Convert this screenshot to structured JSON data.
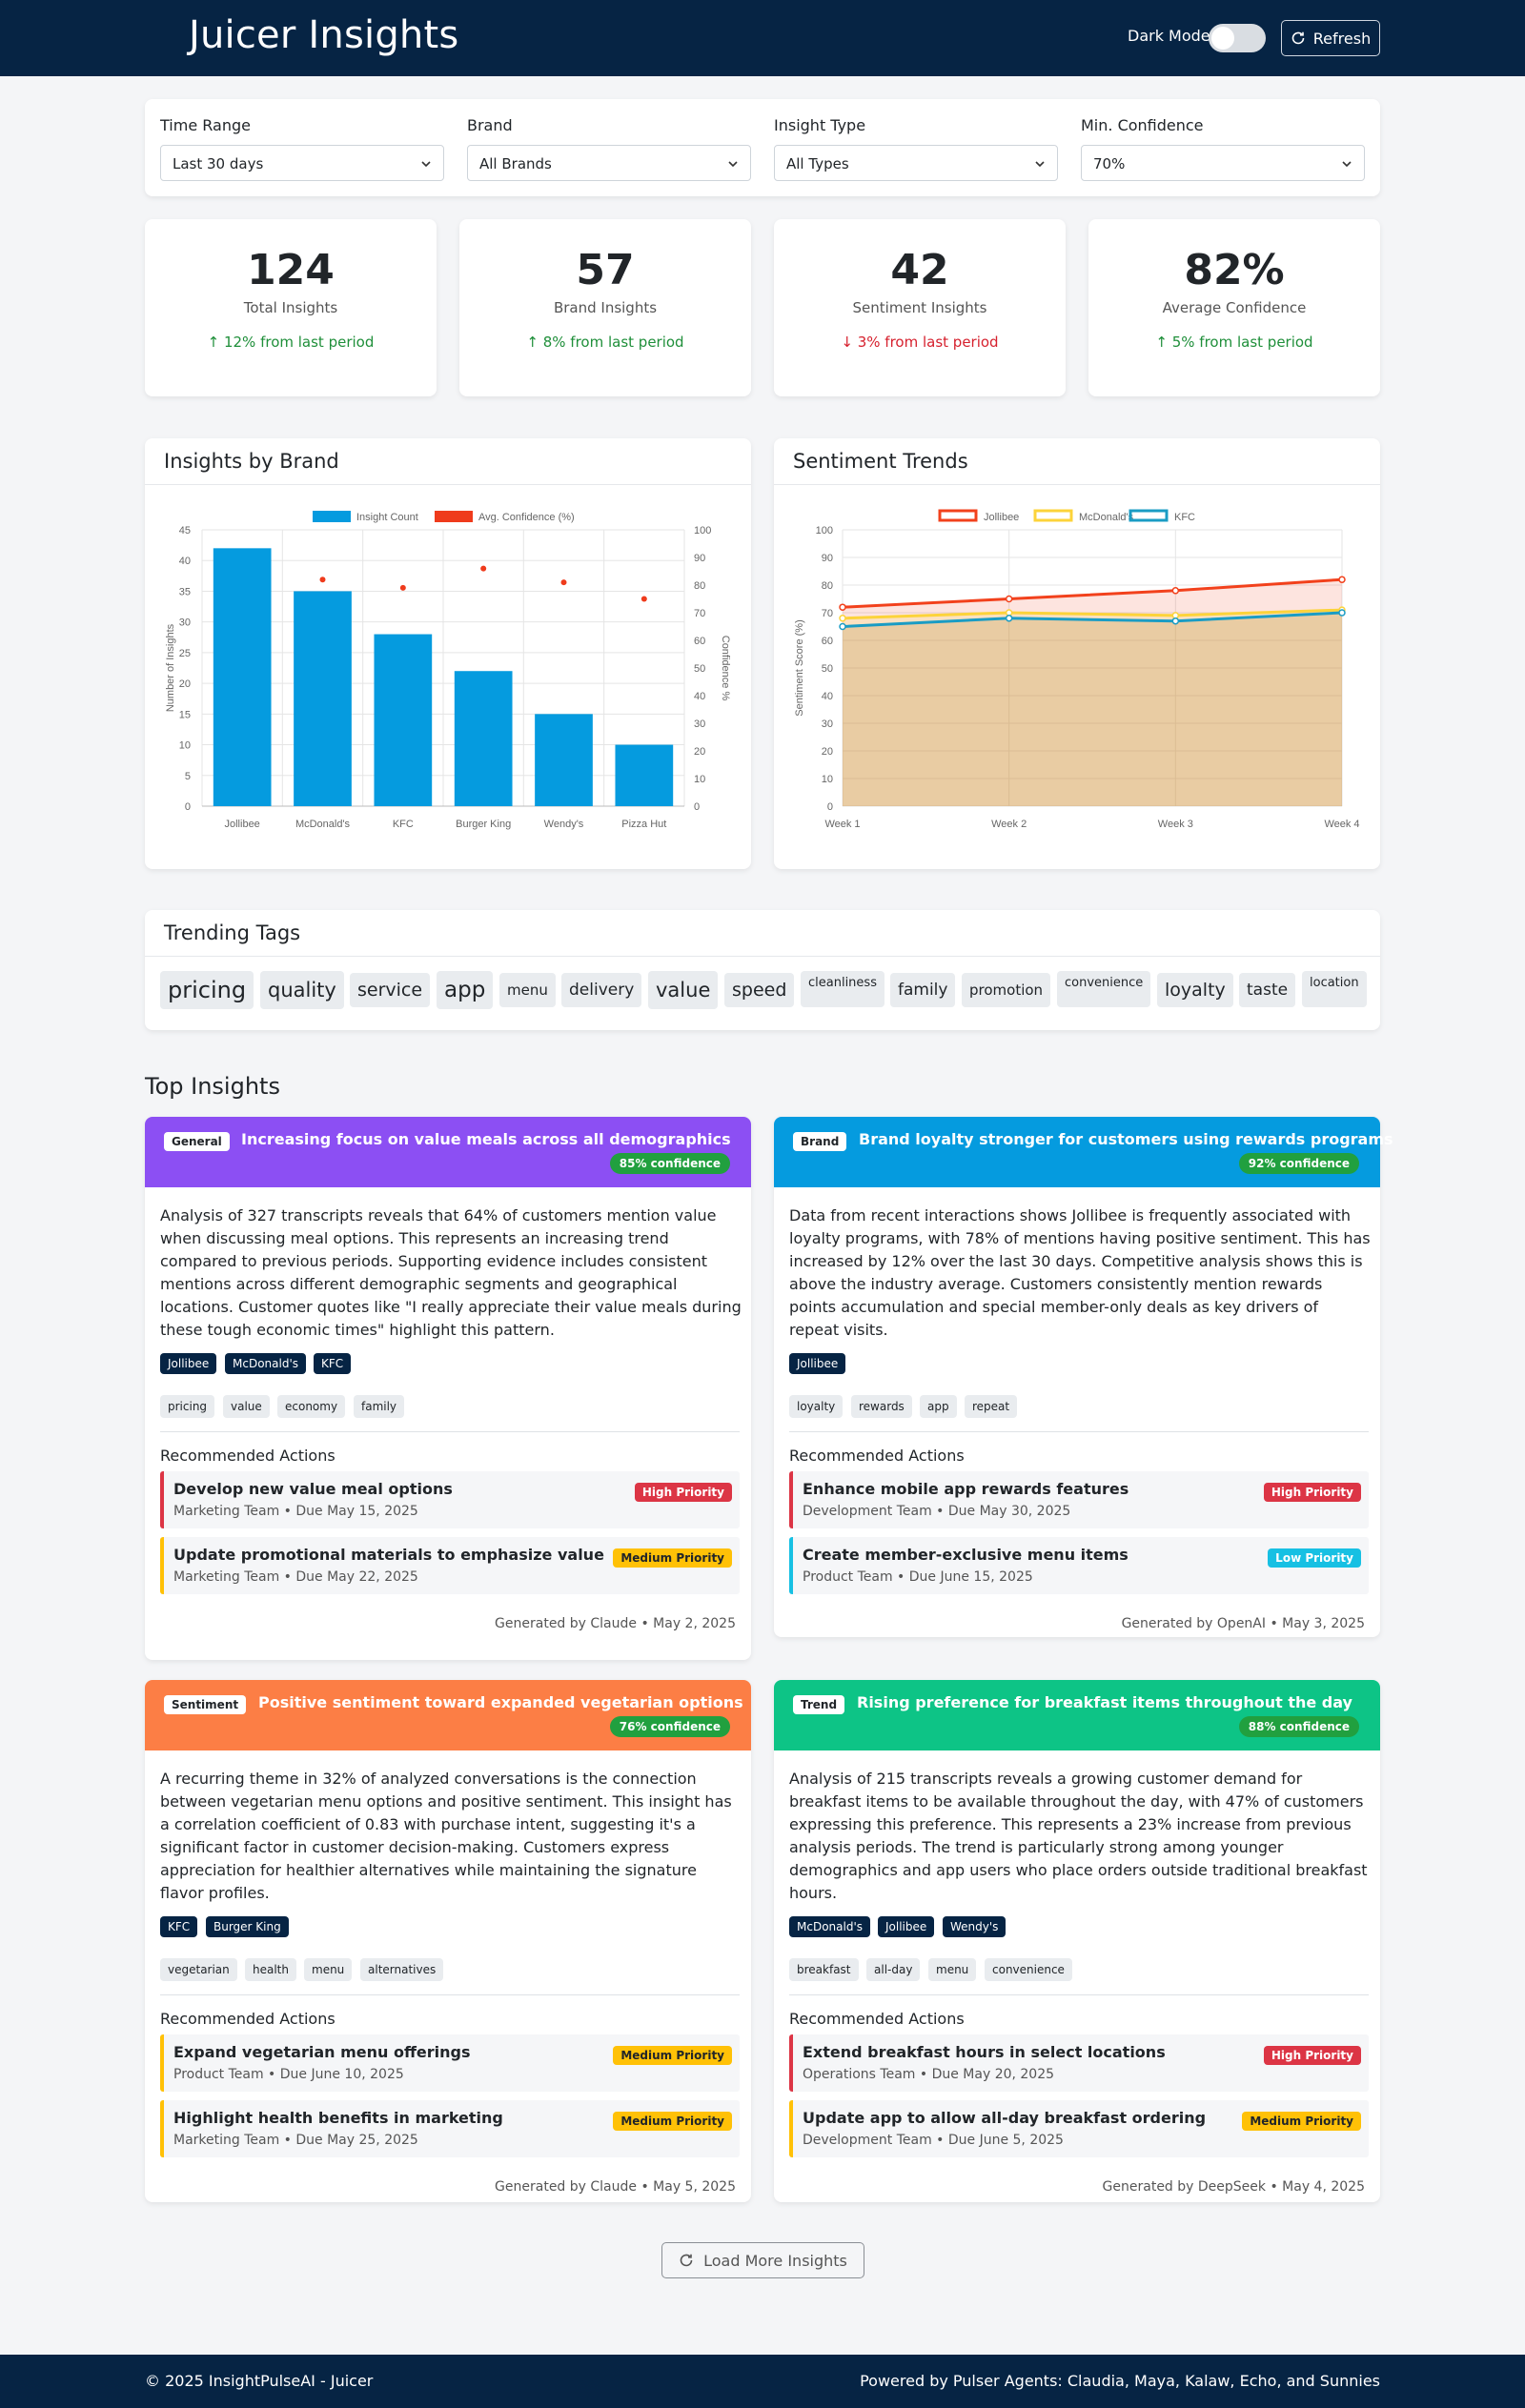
{
  "header": {
    "title": "Juicer Insights",
    "dark_mode_label": "Dark Mode",
    "dark_mode_on": false,
    "refresh_label": "Refresh"
  },
  "filters": [
    {
      "label": "Time Range",
      "value": "Last 30 days"
    },
    {
      "label": "Brand",
      "value": "All Brands"
    },
    {
      "label": "Insight Type",
      "value": "All Types"
    },
    {
      "label": "Min. Confidence",
      "value": "70%"
    }
  ],
  "stats": [
    {
      "value": "124",
      "label": "Total Insights",
      "change": "12% from last period",
      "direction": "up"
    },
    {
      "value": "57",
      "label": "Brand Insights",
      "change": "8% from last period",
      "direction": "up"
    },
    {
      "value": "42",
      "label": "Sentiment Insights",
      "change": "3% from last period",
      "direction": "down"
    },
    {
      "value": "82%",
      "label": "Average Confidence",
      "change": "5% from last period",
      "direction": "up"
    }
  ],
  "brand_chart_card": {
    "title": "Insights by Brand"
  },
  "sentiment_chart_card": {
    "title": "Sentiment Trends"
  },
  "chart_data": [
    {
      "type": "bar",
      "categories": [
        "Jollibee",
        "McDonald's",
        "KFC",
        "Burger King",
        "Wendy's",
        "Pizza Hut"
      ],
      "series": [
        {
          "name": "Insight Count",
          "values": [
            42,
            35,
            28,
            22,
            15,
            10
          ],
          "color": "#059bdf",
          "axis": "left"
        },
        {
          "name": "Avg. Confidence (%)",
          "values": [
            null,
            82,
            79,
            86,
            81,
            75
          ],
          "color": "#ef3b1c",
          "axis": "right",
          "style": "point"
        }
      ],
      "ylabel": "Number of Insights",
      "y2label": "Confidence %",
      "ylim": [
        0,
        45
      ],
      "y2lim": [
        0,
        100
      ],
      "yticks": [
        0,
        5,
        10,
        15,
        20,
        25,
        30,
        35,
        40,
        45
      ],
      "y2ticks": [
        0,
        10,
        20,
        30,
        40,
        50,
        60,
        70,
        80,
        90,
        100
      ],
      "grid": true,
      "legend": "top"
    },
    {
      "type": "line",
      "categories": [
        "Week 1",
        "Week 2",
        "Week 3",
        "Week 4"
      ],
      "series": [
        {
          "name": "Jollibee",
          "values": [
            72,
            75,
            78,
            82
          ],
          "color": "#f2411c"
        },
        {
          "name": "McDonald's",
          "values": [
            68,
            70,
            69,
            71
          ],
          "color": "#fcd33a"
        },
        {
          "name": "KFC",
          "values": [
            65,
            68,
            67,
            70
          ],
          "color": "#1a9cc4"
        }
      ],
      "ylabel": "Sentiment Score (%)",
      "ylim": [
        0,
        100
      ],
      "yticks": [
        0,
        10,
        20,
        30,
        40,
        50,
        60,
        70,
        80,
        90,
        100
      ],
      "grid": true,
      "legend": "top"
    }
  ],
  "trending": {
    "title": "Trending Tags",
    "tags": [
      "pricing",
      "quality",
      "service",
      "app",
      "menu",
      "delivery",
      "value",
      "speed",
      "cleanliness",
      "family",
      "promotion",
      "convenience",
      "loyalty",
      "taste",
      "location"
    ]
  },
  "top_insights_title": "Top Insights",
  "insights": [
    {
      "type": "General",
      "color": "#8c4ff3",
      "title": "Increasing focus on value meals across all demographics",
      "confidence": "85% confidence",
      "description": "Analysis of 327 transcripts reveals that 64% of customers mention value when discussing meal options. This represents an increasing trend compared to previous periods. Supporting evidence includes consistent mentions across different demographic segments and geographical locations. Customer quotes like \"I really appreciate their value meals during these tough economic times\" highlight this pattern.",
      "brands": [
        "Jollibee",
        "McDonald's",
        "KFC"
      ],
      "keywords": [
        "pricing",
        "value",
        "economy",
        "family"
      ],
      "actions_title": "Recommended Actions",
      "actions": [
        {
          "title": "Develop new value meal options",
          "meta": "Marketing Team • Due May 15, 2025",
          "priority": "High Priority",
          "level": "high"
        },
        {
          "title": "Update promotional materials to emphasize value",
          "meta": "Marketing Team • Due May 22, 2025",
          "priority": "Medium Priority",
          "level": "medium"
        }
      ],
      "generated": "Generated by Claude • May 2, 2025"
    },
    {
      "type": "Brand",
      "color": "#059bdf",
      "title": "Brand loyalty stronger for customers using rewards programs",
      "confidence": "92% confidence",
      "description": "Data from recent interactions shows Jollibee is frequently associated with loyalty programs, with 78% of mentions having positive sentiment. This has increased by 12% over the last 30 days. Competitive analysis shows this is above the industry average. Customers consistently mention rewards points accumulation and special member-only deals as key drivers of repeat visits.",
      "brands": [
        "Jollibee"
      ],
      "keywords": [
        "loyalty",
        "rewards",
        "app",
        "repeat"
      ],
      "actions_title": "Recommended Actions",
      "actions": [
        {
          "title": "Enhance mobile app rewards features",
          "meta": "Development Team • Due May 30, 2025",
          "priority": "High Priority",
          "level": "high"
        },
        {
          "title": "Create member-exclusive menu items",
          "meta": "Product Team • Due June 15, 2025",
          "priority": "Low Priority",
          "level": "low"
        }
      ],
      "generated": "Generated by OpenAI • May 3, 2025"
    },
    {
      "type": "Sentiment",
      "color": "#fc7e45",
      "title": "Positive sentiment toward expanded vegetarian options",
      "confidence": "76% confidence",
      "description": "A recurring theme in 32% of analyzed conversations is the connection between vegetarian menu options and positive sentiment. This insight has a correlation coefficient of 0.83 with purchase intent, suggesting it's a significant factor in customer decision-making. Customers express appreciation for healthier alternatives while maintaining the signature flavor profiles.",
      "brands": [
        "KFC",
        "Burger King"
      ],
      "keywords": [
        "vegetarian",
        "health",
        "menu",
        "alternatives"
      ],
      "actions_title": "Recommended Actions",
      "actions": [
        {
          "title": "Expand vegetarian menu offerings",
          "meta": "Product Team • Due June 10, 2025",
          "priority": "Medium Priority",
          "level": "medium"
        },
        {
          "title": "Highlight health benefits in marketing",
          "meta": "Marketing Team • Due May 25, 2025",
          "priority": "Medium Priority",
          "level": "medium"
        }
      ],
      "generated": "Generated by Claude • May 5, 2025"
    },
    {
      "type": "Trend",
      "color": "#0dc486",
      "title": "Rising preference for breakfast items throughout the day",
      "confidence": "88% confidence",
      "description": "Analysis of 215 transcripts reveals a growing customer demand for breakfast items to be available throughout the day, with 47% of customers expressing this preference. This represents a 23% increase from previous analysis periods. The trend is particularly strong among younger demographics and app users who place orders outside traditional breakfast hours.",
      "brands": [
        "McDonald's",
        "Jollibee",
        "Wendy's"
      ],
      "keywords": [
        "breakfast",
        "all-day",
        "menu",
        "convenience"
      ],
      "actions_title": "Recommended Actions",
      "actions": [
        {
          "title": "Extend breakfast hours in select locations",
          "meta": "Operations Team • Due May 20, 2025",
          "priority": "High Priority",
          "level": "high"
        },
        {
          "title": "Update app to allow all-day breakfast ordering",
          "meta": "Development Team • Due June 5, 2025",
          "priority": "Medium Priority",
          "level": "medium"
        }
      ],
      "generated": "Generated by DeepSeek • May 4, 2025"
    }
  ],
  "load_more_label": "Load More Insights",
  "footer": {
    "left": "© 2025 InsightPulseAI - Juicer",
    "right": "Powered by Pulser Agents: Claudia, Maya, Kalaw, Echo, and Sunnies"
  }
}
